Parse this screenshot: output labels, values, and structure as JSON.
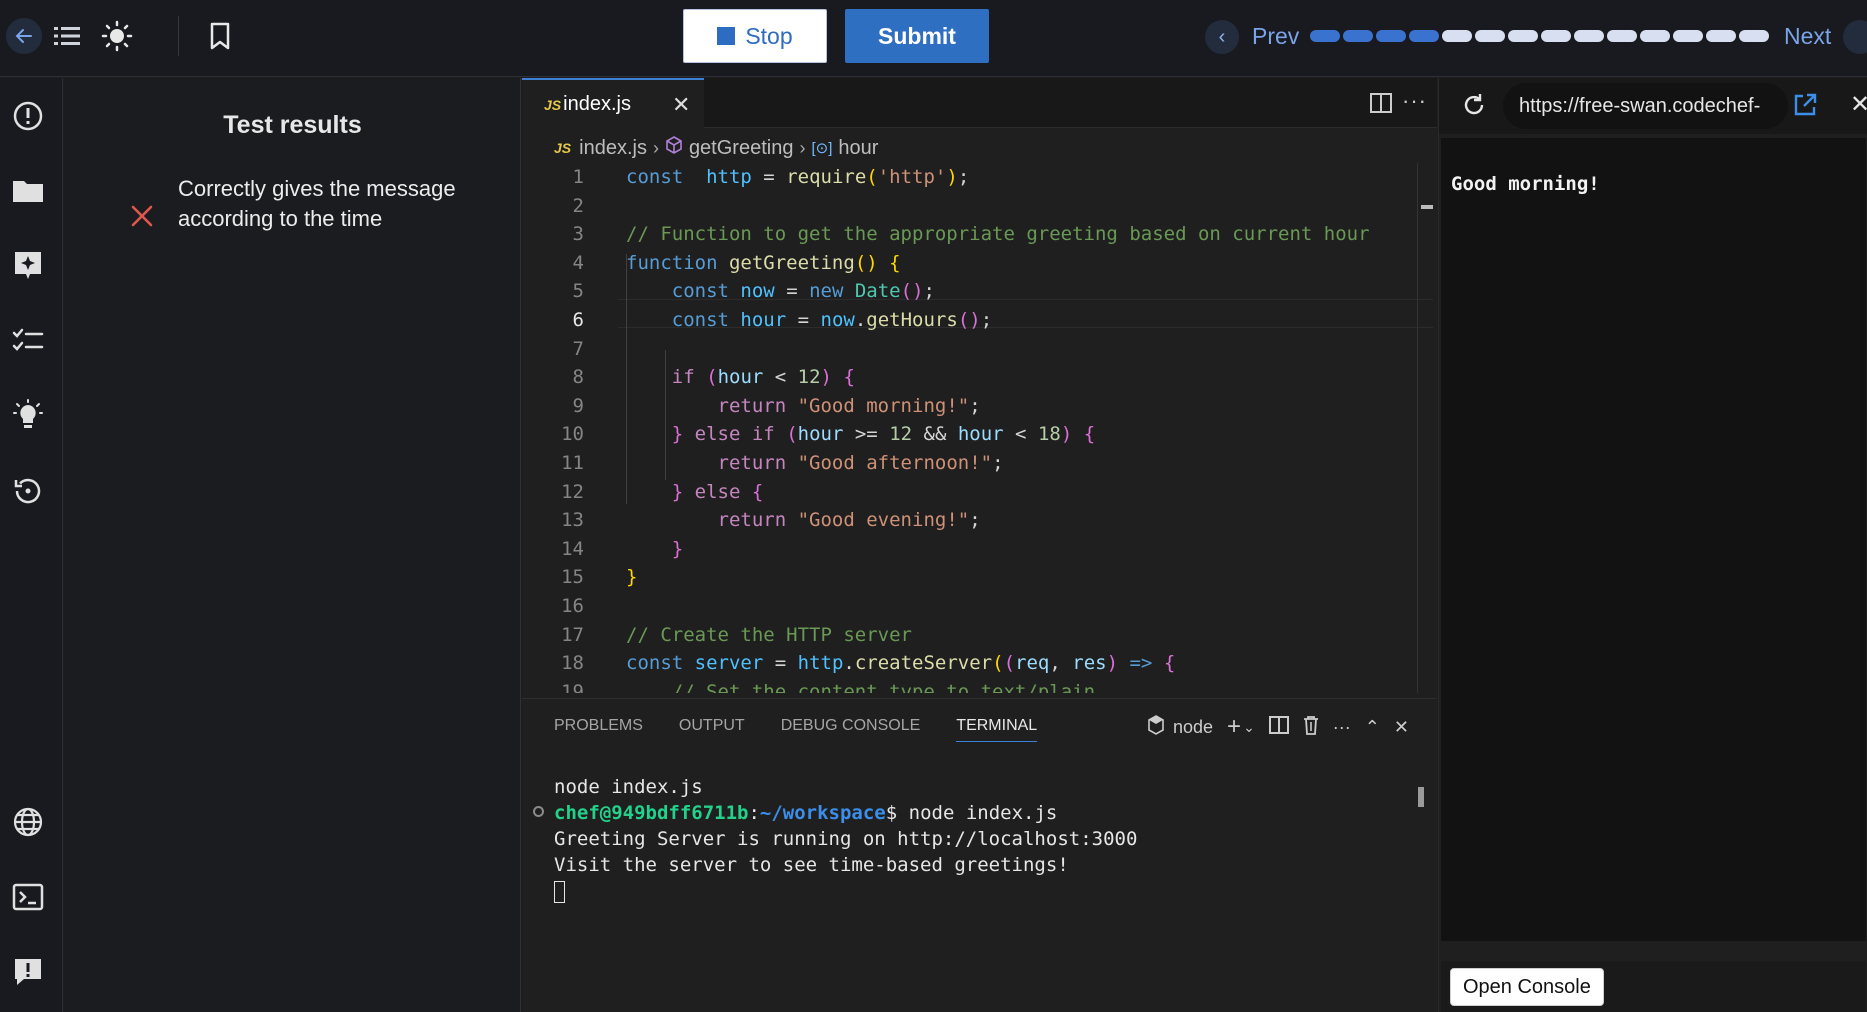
{
  "toolbar": {
    "stop_label": "Stop",
    "submit_label": "Submit",
    "prev_label": "Prev",
    "next_label": "Next",
    "progress": {
      "total": 14,
      "completed": 4
    }
  },
  "results": {
    "title": "Test results",
    "items": [
      {
        "status": "failed",
        "text": "Correctly gives the message according to the time"
      }
    ]
  },
  "editor": {
    "tab_label": "index.js",
    "file_badge": "JS",
    "breadcrumb": [
      "index.js",
      "getGreeting",
      "hour"
    ],
    "current_line": 6,
    "line_numbers": [
      "1",
      "2",
      "3",
      "4",
      "5",
      "6",
      "7",
      "8",
      "9",
      "10",
      "11",
      "12",
      "13",
      "14",
      "15",
      "16",
      "17",
      "18",
      "19"
    ]
  },
  "panel": {
    "tabs": [
      "PROBLEMS",
      "OUTPUT",
      "DEBUG CONSOLE",
      "TERMINAL"
    ],
    "active_tab": "TERMINAL",
    "shell_label": "node",
    "terminal": {
      "line1": "node index.js",
      "prompt_user": "chef@949bdff6711b",
      "prompt_sep": ":",
      "prompt_path": "~/workspace",
      "prompt_cmd": "$ node index.js",
      "line3": "Greeting Server is running on http://localhost:3000",
      "line4": "Visit the server to see time-based greetings!"
    }
  },
  "preview": {
    "url": "https://free-swan.codechef-",
    "body_text": "Good morning!",
    "open_console_label": "Open Console"
  },
  "colors": {
    "accent": "#2f6fc2",
    "progress_done": "#3a73cf",
    "progress_todo": "#d7dff0",
    "fail": "#e0584b"
  }
}
